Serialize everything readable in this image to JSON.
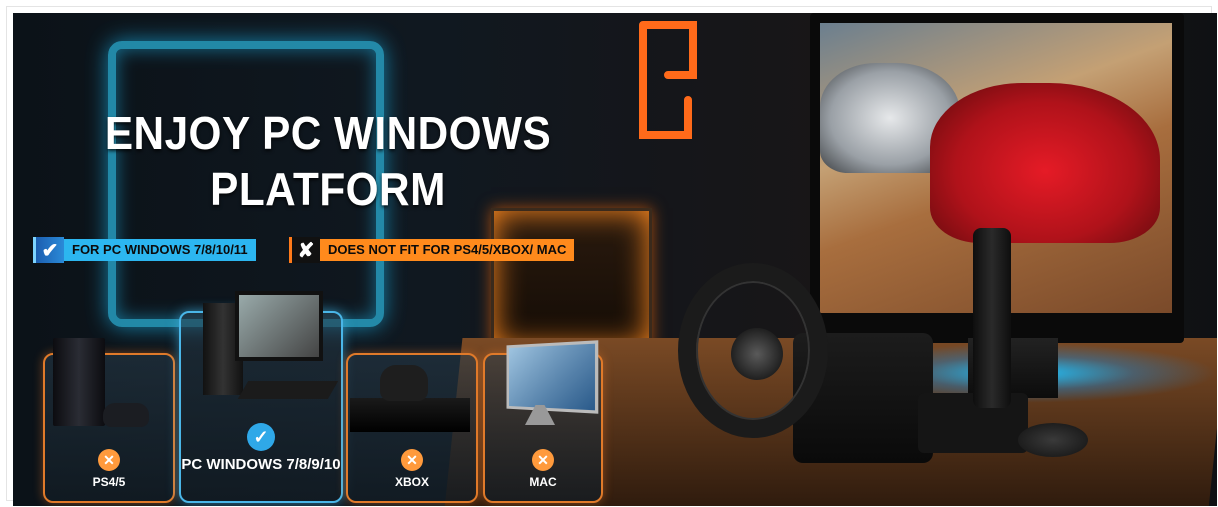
{
  "banner": {
    "headline": {
      "line1": "ENJOY PC WINDOWS",
      "line2": "PLATFORM"
    },
    "compatible_badge": {
      "icon": "check-icon",
      "text": "FOR PC WINDOWS 7/8/10/11"
    },
    "incompatible_badge": {
      "icon": "x-icon",
      "text": "DOES NOT FIT FOR PS4/5/XBOX/ MAC"
    },
    "platforms": [
      {
        "label": "PS4/5",
        "status": "unsupported",
        "icon": "x-icon"
      },
      {
        "label": "PC WINDOWS 7/8/9/10",
        "status": "supported",
        "icon": "check-icon"
      },
      {
        "label": "XBOX",
        "status": "unsupported",
        "icon": "x-icon"
      },
      {
        "label": "MAC",
        "status": "unsupported",
        "icon": "x-icon"
      }
    ],
    "colors": {
      "accent_blue": "#2cb6f0",
      "accent_orange": "#ff8a1c"
    }
  }
}
